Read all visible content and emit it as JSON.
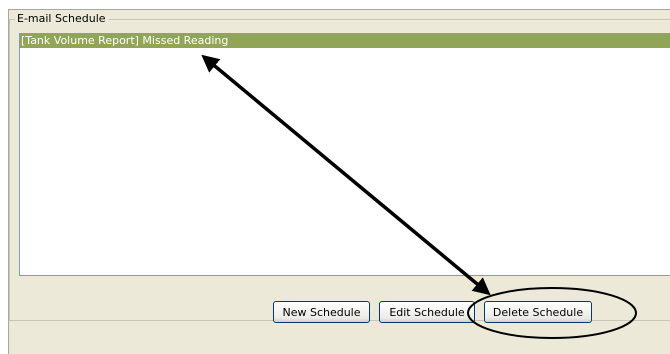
{
  "groupbox": {
    "title": "E-mail Schedule"
  },
  "schedule_list": {
    "items": [
      {
        "label": "[Tank Volume Report] Missed Reading",
        "selected": true
      }
    ]
  },
  "buttons": {
    "new_label": "New Schedule",
    "edit_label": "Edit Schedule",
    "delete_label": "Delete Schedule"
  },
  "colors": {
    "selection": "#92a455",
    "panel_background": "#ece9d8",
    "annotation": "#000000"
  }
}
